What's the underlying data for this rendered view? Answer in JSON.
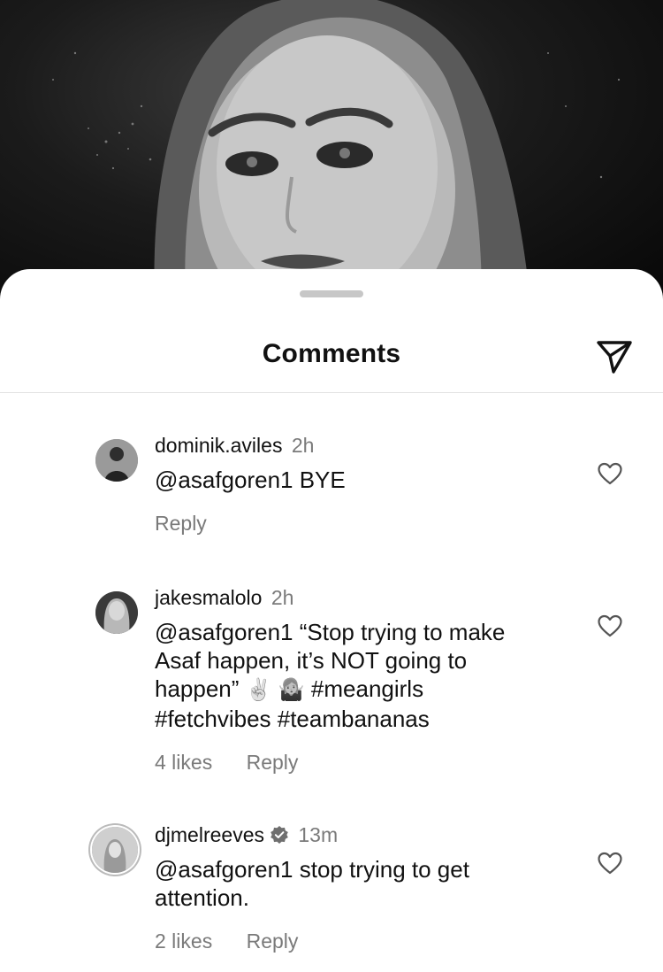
{
  "sheet": {
    "title": "Comments",
    "send_icon": "paper-plane-icon"
  },
  "comments": [
    {
      "username": "dominik.aviles",
      "time": "2h",
      "text": "@asafgoren1 BYE",
      "likes": "",
      "reply_label": "Reply",
      "verified": false
    },
    {
      "username": "jakesmalolo",
      "time": "2h",
      "text_line1": "@asafgoren1 “Stop trying to make",
      "text_line2": "Asaf happen, it’s NOT going to",
      "text_line3_pre": "happen”",
      "emoji1": "✌🏻",
      "emoji2": "🤷🏼‍♀️",
      "text_line3_post": "#meangirls",
      "text_line4": "#fetchvibes #teambananas",
      "likes": "4 likes",
      "reply_label": "Reply",
      "verified": false
    },
    {
      "username": "djmelreeves",
      "time": "13m",
      "text": "@asafgoren1 stop trying to get attention.",
      "likes": "2 likes",
      "reply_label": "Reply",
      "verified": true
    }
  ],
  "icons": {
    "heart": "heart-icon",
    "verified": "verified-badge-icon"
  }
}
